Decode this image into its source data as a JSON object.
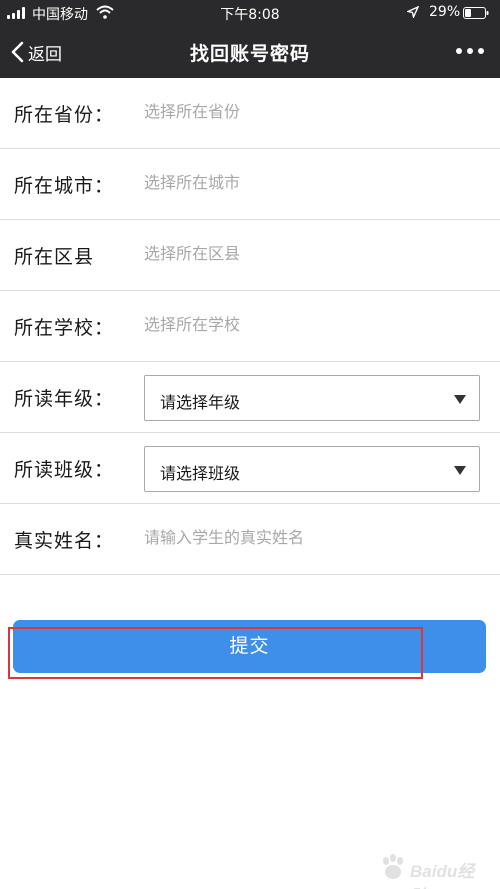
{
  "status_bar": {
    "carrier": "中国移动",
    "time": "下午8:08",
    "battery_percent": "29%"
  },
  "nav": {
    "back_label": "返回",
    "title": "找回账号密码"
  },
  "form": {
    "province": {
      "label": "所在省份：",
      "placeholder": "选择所在省份"
    },
    "city": {
      "label": "所在城市：",
      "placeholder": "选择所在城市"
    },
    "district": {
      "label": "所在区县",
      "placeholder": "选择所在区县"
    },
    "school": {
      "label": "所在学校：",
      "placeholder": "选择所在学校"
    },
    "grade": {
      "label": "所读年级：",
      "selected": "请选择年级"
    },
    "class": {
      "label": "所读班级：",
      "selected": "请选择班级"
    },
    "real_name": {
      "label": "真实姓名：",
      "placeholder": "请输入学生的真实姓名"
    }
  },
  "submit": {
    "label": "提交"
  },
  "colors": {
    "topbar": "#2a2a2c",
    "submit": "#3d8fe9",
    "highlight": "#d9363e"
  },
  "watermark": {
    "text": "Baidu经验"
  }
}
